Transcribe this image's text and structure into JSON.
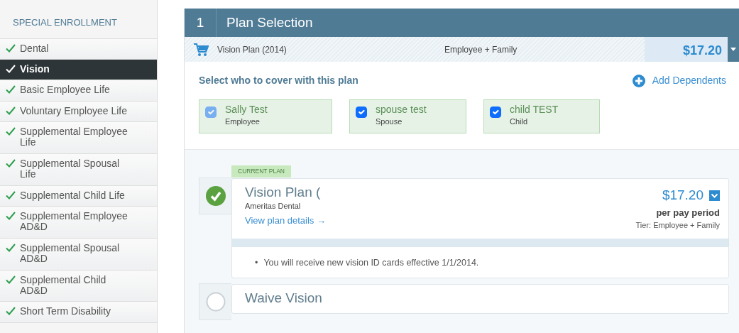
{
  "sidebar": {
    "title": "SPECIAL ENROLLMENT",
    "items": [
      {
        "label": "Dental",
        "selected": false
      },
      {
        "label": "Vision",
        "selected": true
      },
      {
        "label": "Basic Employee Life",
        "selected": false
      },
      {
        "label": "Voluntary Employee Life",
        "selected": false
      },
      {
        "label": "Supplemental Employee Life",
        "selected": false
      },
      {
        "label": "Supplemental Spousal Life",
        "selected": false
      },
      {
        "label": "Supplemental Child Life",
        "selected": false
      },
      {
        "label": "Supplemental Employee AD&D",
        "selected": false
      },
      {
        "label": "Supplemental Spousal AD&D",
        "selected": false
      },
      {
        "label": "Supplemental Child AD&D",
        "selected": false
      },
      {
        "label": "Short Term Disability",
        "selected": false
      }
    ]
  },
  "step": {
    "number": "1",
    "title": "Plan Selection"
  },
  "cart": {
    "plan": "Vision Plan (2014)",
    "tier": "Employee + Family",
    "price": "$17.20"
  },
  "coverage": {
    "heading": "Select who to cover with this plan",
    "add_label": "Add Dependents",
    "members": [
      {
        "name": "Sally Test",
        "role": "Employee",
        "checked": true,
        "disabled": true
      },
      {
        "name": "spouse test",
        "role": "Spouse",
        "checked": true,
        "disabled": false
      },
      {
        "name": "child TEST",
        "role": "Child",
        "checked": true,
        "disabled": false
      }
    ]
  },
  "plans": [
    {
      "badge": "CURRENT PLAN",
      "name": "Vision Plan (",
      "carrier": "Ameritas Dental",
      "link": "View plan details →",
      "price": "$17.20",
      "period": "per pay period",
      "tier": "Tier: Employee + Family",
      "bullet": "•",
      "notes": [
        "You will receive new vision ID cards effective 1/1/2014."
      ],
      "selected": true
    },
    {
      "name": "Waive Vision",
      "selected": false
    }
  ]
}
